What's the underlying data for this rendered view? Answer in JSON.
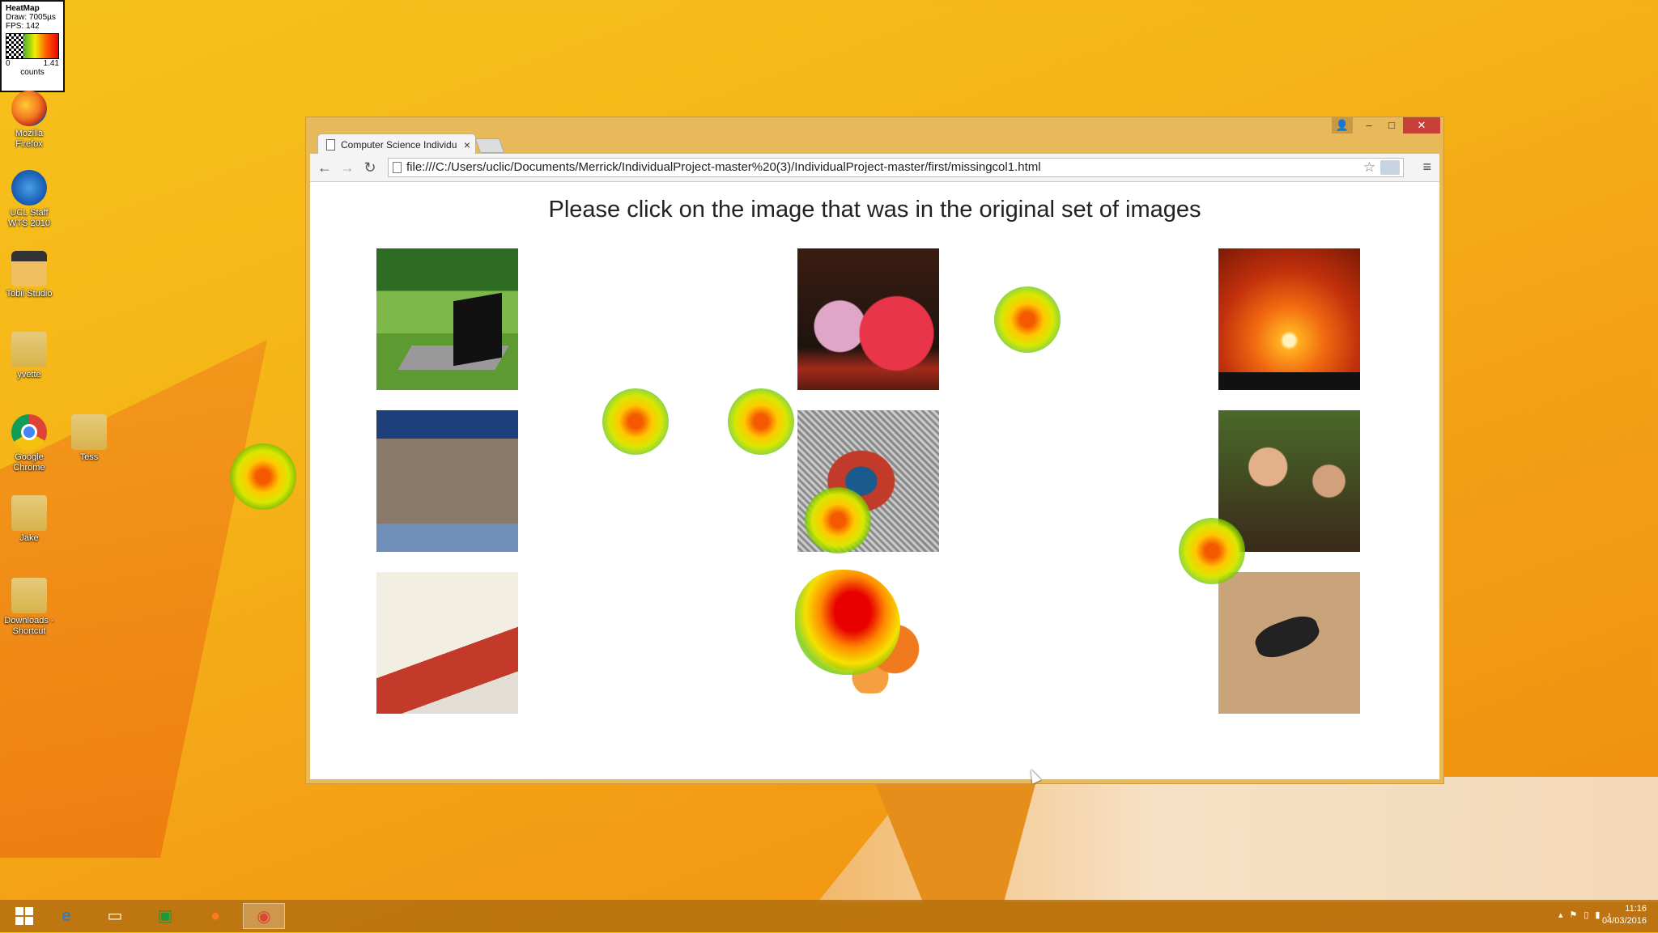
{
  "heatmap_legend": {
    "title": "HeatMap",
    "draw": "Draw: 7005µs",
    "fps": "FPS: 142",
    "min": "0",
    "max": "1.41",
    "unit": "counts"
  },
  "desktop_icons": [
    {
      "label_1": "Mozilla",
      "label_2": "Firefox"
    },
    {
      "label_1": "UCL Staff",
      "label_2": "WTS 2010"
    },
    {
      "label_1": "Tobii Studio",
      "label_2": ""
    },
    {
      "label_1": "yvette",
      "label_2": ""
    },
    {
      "label_1": "Google",
      "label_2": "Chrome"
    },
    {
      "label_1": "Tess",
      "label_2": ""
    },
    {
      "label_1": "Jake",
      "label_2": ""
    },
    {
      "label_1": "Downloads -",
      "label_2": "Shortcut"
    }
  ],
  "browser": {
    "tab_title": "Computer Science Individu",
    "url": "file:///C:/Users/uclic/Documents/Merrick/IndividualProject-master%20(3)/IndividualProject-master/first/missingcol1.html",
    "page_heading": "Please click on the image that was in the original set of images",
    "window_controls": {
      "minimize": "–",
      "maximize": "□",
      "close": "✕"
    },
    "nav_icons": {
      "back": "←",
      "forward": "→",
      "reload": "↻"
    },
    "images": [
      {
        "name": "laptop-on-grass"
      },
      {
        "name": "candy-jars"
      },
      {
        "name": "sunset"
      },
      {
        "name": "city-skyline"
      },
      {
        "name": "crab"
      },
      {
        "name": "toy-figurines"
      },
      {
        "name": "open-book"
      },
      {
        "name": "oranges"
      },
      {
        "name": "scorpion"
      }
    ]
  },
  "taskbar": {
    "time": "11:16",
    "date": "04/03/2016"
  }
}
